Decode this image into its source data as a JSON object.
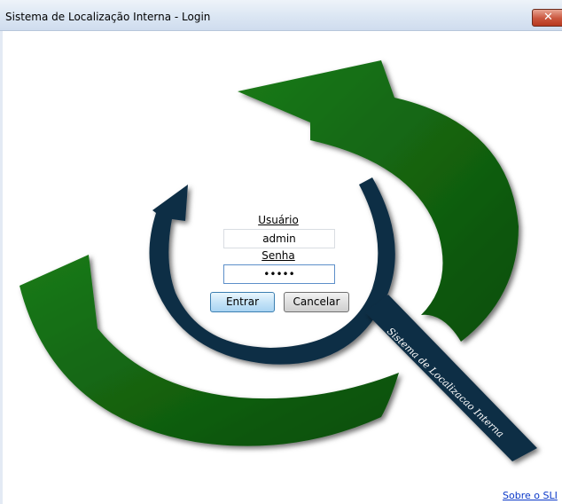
{
  "window": {
    "title": "Sistema de Localização Interna - Login",
    "close_symbol": "✕"
  },
  "logo": {
    "text": "Sistema de Localizacao Interna",
    "colors": {
      "green": "#11620f",
      "navy": "#112e45"
    }
  },
  "form": {
    "username_label": "Usuário",
    "username_value": "admin",
    "password_label": "Senha",
    "password_value": "•••••",
    "enter_label": "Entrar",
    "cancel_label": "Cancelar"
  },
  "footer": {
    "about_link": "Sobre o SLI"
  }
}
